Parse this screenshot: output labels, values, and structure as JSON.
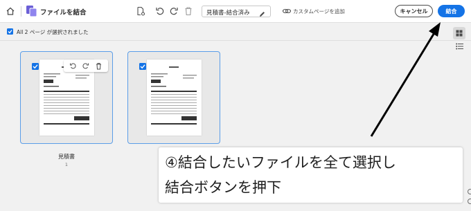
{
  "toolbar": {
    "app_title": "ファイルを結合",
    "filename": "見積書-結合済み",
    "custom_page_label": "カスタムページを追加",
    "cancel_label": "キャンセル",
    "combine_label": "結合",
    "accent_color": "#1473e6"
  },
  "selection": {
    "text": "All 2 ページ が選択されました"
  },
  "icons": {
    "home": "home-icon",
    "app": "combine-files-icon",
    "doc_settings": "document-gear-icon",
    "undo": "undo-icon",
    "redo": "redo-icon",
    "trash": "trash-icon",
    "edit": "pencil-icon",
    "custom_page": "link-icon",
    "grid_view": "grid-view-icon",
    "list_view": "list-view-icon"
  },
  "files": [
    {
      "name": "見積書",
      "page_count": "1"
    }
  ],
  "annotation": {
    "line1": "④結合したいファイルを全て選択し",
    "line2": "結合ボタンを押下"
  }
}
